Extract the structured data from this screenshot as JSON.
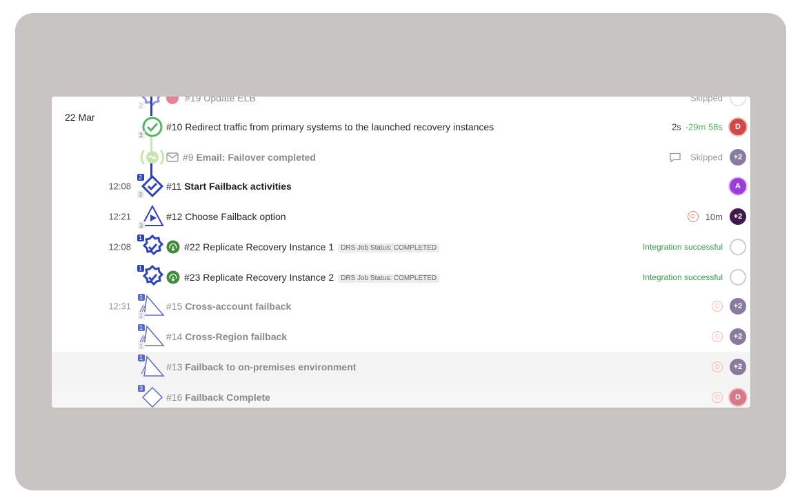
{
  "date_header": "22 Mar",
  "rows": [
    {
      "time": "",
      "num": "#19",
      "label": "Update ELB",
      "status": "Skipped",
      "avatar": ""
    },
    {
      "time": "",
      "num": "#10",
      "label": "Redirect traffic from primary systems to the launched recovery instances",
      "duration": "2s",
      "delta": "-29m 58s",
      "avatar": "D"
    },
    {
      "time": "",
      "num": "#9",
      "label": "Email: Failover completed",
      "status": "Skipped",
      "avatar": "+2"
    },
    {
      "time": "12:08",
      "num": "#11",
      "label": "Start Failback activities",
      "avatar": "A"
    },
    {
      "time": "12:21",
      "num": "#12",
      "label": "Choose Failback option",
      "duration": "10m",
      "avatar": "+2"
    },
    {
      "time": "12:08",
      "num": "#22",
      "label": "Replicate Recovery Instance 1",
      "tag": "DRS Job Status: COMPLETED",
      "status": "Integration successful"
    },
    {
      "time": "",
      "num": "#23",
      "label": "Replicate Recovery Instance 2",
      "tag": "DRS Job Status: COMPLETED",
      "status": "Integration successful"
    },
    {
      "time": "12:31",
      "num": "#15",
      "label": "Cross-account failback",
      "avatar": "+2"
    },
    {
      "time": "",
      "num": "#14",
      "label": "Cross-Region failback",
      "avatar": "+2"
    },
    {
      "time": "",
      "num": "#13",
      "label": "Failback to on-premises environment",
      "avatar": "+2"
    },
    {
      "time": "",
      "num": "#16",
      "label": "Failback Complete",
      "avatar": "D"
    }
  ],
  "node_badges": {
    "n19": "2",
    "n10": "2",
    "n11_top": "2",
    "n11_bot": "3",
    "n12": "3",
    "n22": "1",
    "n23": "1",
    "n15_top": "1",
    "n15_bot": "1",
    "n14_top": "1",
    "n14_bot": "1",
    "n13": "1",
    "n16": "3"
  },
  "copyright_glyph": "©",
  "colors": {
    "blue": "#2d43b5",
    "green": "#55b36b",
    "frame": "#c8c4c3"
  }
}
